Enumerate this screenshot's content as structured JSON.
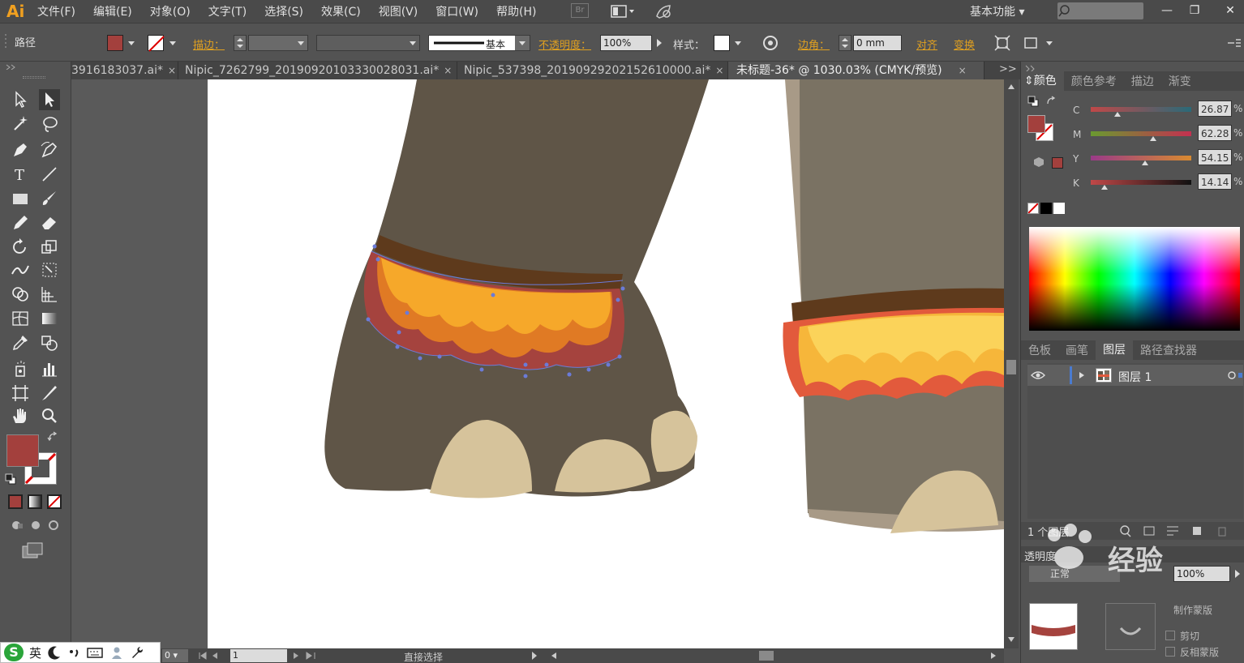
{
  "app": {
    "logo": "Ai",
    "menu": [
      "文件(F)",
      "编辑(E)",
      "对象(O)",
      "文字(T)",
      "选择(S)",
      "效果(C)",
      "视图(V)",
      "窗口(W)",
      "帮助(H)"
    ],
    "br_label": "Br",
    "workspace": "基本功能",
    "window_controls": [
      "—",
      "❐",
      "✕"
    ]
  },
  "control_bar": {
    "object_type": "路径",
    "stroke_label": "描边：",
    "stroke_style": "基本",
    "opacity_label": "不透明度：",
    "opacity_value": "100%",
    "style_label": "样式：",
    "corner_label": "边角：",
    "corner_value": "0 mm",
    "align_label": "对齐",
    "transform_label": "变换"
  },
  "tabs": [
    {
      "label": "3916183037.ai*",
      "close": "×"
    },
    {
      "label": "Nipic_7262799_20190920103330028031.ai*",
      "close": "×"
    },
    {
      "label": "Nipic_537398_20190929202152610000.ai*",
      "close": "×"
    },
    {
      "label": "未标题-36* @ 1030.03% (CMYK/预览)",
      "close": "×"
    }
  ],
  "tabs_overflow": ">>",
  "colors": {
    "fill": "#a3403d",
    "stroke": "#ffffff",
    "accent": "#e0a020"
  },
  "color_panel": {
    "tabs": [
      "颜色",
      "颜色参考",
      "描边",
      "渐变"
    ],
    "channels": [
      {
        "label": "C",
        "value": "26.87",
        "unit": "%",
        "level": 0.27
      },
      {
        "label": "M",
        "value": "62.28",
        "unit": "%",
        "level": 0.62
      },
      {
        "label": "Y",
        "value": "54.15",
        "unit": "%",
        "level": 0.54
      },
      {
        "label": "K",
        "value": "14.14",
        "unit": "%",
        "level": 0.14
      }
    ]
  },
  "layers_panel": {
    "tabs": [
      "色板",
      "画笔",
      "图层",
      "路径查找器"
    ],
    "layers": [
      {
        "name": "图层 1"
      }
    ],
    "count": "1 个图层"
  },
  "transparency_panel": {
    "title": "透明度",
    "mode": "正常",
    "opacity": "100%",
    "make_mask": "制作蒙版",
    "clip": "剪切",
    "invert_mask": "反相蒙版"
  },
  "status_bar": {
    "zoom_value": "0",
    "page_value": "1",
    "tool_name": "直接选择"
  },
  "ime": {
    "logo": "S",
    "lang": "英"
  },
  "watermark": "经验"
}
